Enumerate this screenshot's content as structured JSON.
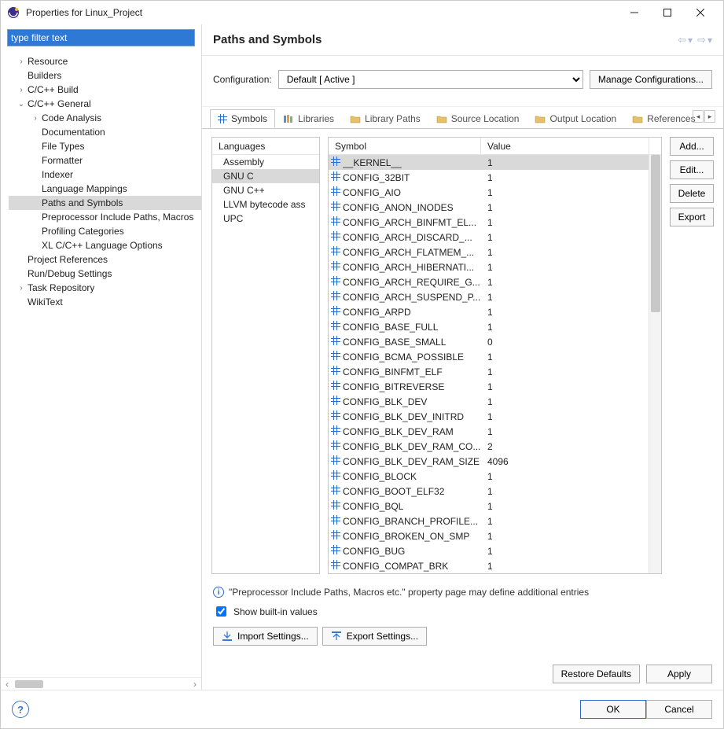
{
  "window": {
    "title": "Properties for Linux_Project"
  },
  "filter_placeholder": "type filter text",
  "tree": [
    {
      "label": "Resource",
      "indent": 0,
      "twist": "›",
      "selected": false
    },
    {
      "label": "Builders",
      "indent": 0,
      "twist": "",
      "selected": false
    },
    {
      "label": "C/C++ Build",
      "indent": 0,
      "twist": "›",
      "selected": false
    },
    {
      "label": "C/C++ General",
      "indent": 0,
      "twist": "⌄",
      "selected": false
    },
    {
      "label": "Code Analysis",
      "indent": 1,
      "twist": "›",
      "selected": false
    },
    {
      "label": "Documentation",
      "indent": 1,
      "twist": "",
      "selected": false
    },
    {
      "label": "File Types",
      "indent": 1,
      "twist": "",
      "selected": false
    },
    {
      "label": "Formatter",
      "indent": 1,
      "twist": "",
      "selected": false
    },
    {
      "label": "Indexer",
      "indent": 1,
      "twist": "",
      "selected": false
    },
    {
      "label": "Language Mappings",
      "indent": 1,
      "twist": "",
      "selected": false
    },
    {
      "label": "Paths and Symbols",
      "indent": 1,
      "twist": "",
      "selected": true
    },
    {
      "label": "Preprocessor Include Paths, Macros",
      "indent": 1,
      "twist": "",
      "selected": false
    },
    {
      "label": "Profiling Categories",
      "indent": 1,
      "twist": "",
      "selected": false
    },
    {
      "label": "XL C/C++ Language Options",
      "indent": 1,
      "twist": "",
      "selected": false
    },
    {
      "label": "Project References",
      "indent": 0,
      "twist": "",
      "selected": false
    },
    {
      "label": "Run/Debug Settings",
      "indent": 0,
      "twist": "",
      "selected": false
    },
    {
      "label": "Task Repository",
      "indent": 0,
      "twist": "›",
      "selected": false
    },
    {
      "label": "WikiText",
      "indent": 0,
      "twist": "",
      "selected": false
    }
  ],
  "page": {
    "title": "Paths and Symbols"
  },
  "config": {
    "label": "Configuration:",
    "value": "Default  [ Active ]",
    "manage": "Manage Configurations..."
  },
  "tabs": [
    {
      "label": "Symbols",
      "icon": "hash",
      "active": true
    },
    {
      "label": "Libraries",
      "icon": "books",
      "active": false
    },
    {
      "label": "Library Paths",
      "icon": "folder",
      "active": false
    },
    {
      "label": "Source Location",
      "icon": "folder",
      "active": false
    },
    {
      "label": "Output Location",
      "icon": "folder",
      "active": false
    },
    {
      "label": "References",
      "icon": "folder",
      "active": false
    }
  ],
  "languages": {
    "header": "Languages",
    "items": [
      {
        "label": "Assembly",
        "selected": false
      },
      {
        "label": "GNU C",
        "selected": true
      },
      {
        "label": "GNU C++",
        "selected": false
      },
      {
        "label": "LLVM bytecode ass",
        "selected": false
      },
      {
        "label": "UPC",
        "selected": false
      }
    ]
  },
  "symbols": {
    "col_symbol": "Symbol",
    "col_value": "Value",
    "rows": [
      {
        "name": "__KERNEL__",
        "value": "1",
        "selected": true
      },
      {
        "name": "CONFIG_32BIT",
        "value": "1"
      },
      {
        "name": "CONFIG_AIO",
        "value": "1"
      },
      {
        "name": "CONFIG_ANON_INODES",
        "value": "1"
      },
      {
        "name": "CONFIG_ARCH_BINFMT_EL...",
        "value": "1"
      },
      {
        "name": "CONFIG_ARCH_DISCARD_...",
        "value": "1"
      },
      {
        "name": "CONFIG_ARCH_FLATMEM_...",
        "value": "1"
      },
      {
        "name": "CONFIG_ARCH_HIBERNATI...",
        "value": "1"
      },
      {
        "name": "CONFIG_ARCH_REQUIRE_G...",
        "value": "1"
      },
      {
        "name": "CONFIG_ARCH_SUSPEND_P...",
        "value": "1"
      },
      {
        "name": "CONFIG_ARPD",
        "value": "1"
      },
      {
        "name": "CONFIG_BASE_FULL",
        "value": "1"
      },
      {
        "name": "CONFIG_BASE_SMALL",
        "value": "0"
      },
      {
        "name": "CONFIG_BCMA_POSSIBLE",
        "value": "1"
      },
      {
        "name": "CONFIG_BINFMT_ELF",
        "value": "1"
      },
      {
        "name": "CONFIG_BITREVERSE",
        "value": "1"
      },
      {
        "name": "CONFIG_BLK_DEV",
        "value": "1"
      },
      {
        "name": "CONFIG_BLK_DEV_INITRD",
        "value": "1"
      },
      {
        "name": "CONFIG_BLK_DEV_RAM",
        "value": "1"
      },
      {
        "name": "CONFIG_BLK_DEV_RAM_CO...",
        "value": "2"
      },
      {
        "name": "CONFIG_BLK_DEV_RAM_SIZE",
        "value": "4096"
      },
      {
        "name": "CONFIG_BLOCK",
        "value": "1"
      },
      {
        "name": "CONFIG_BOOT_ELF32",
        "value": "1"
      },
      {
        "name": "CONFIG_BQL",
        "value": "1"
      },
      {
        "name": "CONFIG_BRANCH_PROFILE...",
        "value": "1"
      },
      {
        "name": "CONFIG_BROKEN_ON_SMP",
        "value": "1"
      },
      {
        "name": "CONFIG_BUG",
        "value": "1"
      },
      {
        "name": "CONFIG_COMPAT_BRK",
        "value": "1"
      }
    ]
  },
  "side_buttons": {
    "add": "Add...",
    "edit": "Edit...",
    "delete": "Delete",
    "export": "Export"
  },
  "info_text": "\"Preprocessor Include Paths, Macros etc.\" property page may define additional entries",
  "show_builtin_label": "Show built-in values",
  "show_builtin_checked": true,
  "import_label": "Import Settings...",
  "export_label": "Export Settings...",
  "restore_label": "Restore Defaults",
  "apply_label": "Apply",
  "ok_label": "OK",
  "cancel_label": "Cancel"
}
